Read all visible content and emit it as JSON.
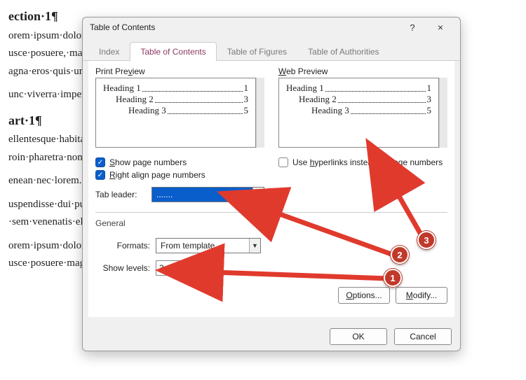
{
  "bg": {
    "heading1": "ection·1¶",
    "p1": "orem·ipsum·dolor·sit·amet,·consectetuer·adipiscing·elit.·Maecenas·porttitor·congue·mass",
    "p2": "usce·posuere,·magna·sed·pulvinar·ultricies,·purus·lectus·malesuada·libero,·sit·amet·commod",
    "p3": "agna·eros·quis·urna.¶",
    "p4": "unc·viverra·imperdiet·enim.·Fusce·est.·Vivamus·a·tellus.¶",
    "heading2": "art·1¶",
    "p5": "ellentesque·habitant·morbi·tristique·senectus·et·netus·et·malesuada·fames·ac·turpis·egesta",
    "p6": "roin·pharetra·nonummy·pede.·Mauris·et·orci.¶",
    "p7": "enean·nec·lorem.·In·porttitor.·Donec·laoreet·nonummy·augue.¶",
    "p8": "uspendisse·dui·purus,·scelerisque·at,·vulputate·vitae,·pretium·mattis,·nunc.·Mauris·eget·nequ",
    "p9": "·sem·venenatis·eleifend.·Ut·nonummy.¶",
    "p10": "orem·ipsum·dolor·sit·amet,·consectetuer·adipiscing·elit.·Maecenas·porttitor·congue·mass",
    "p11": "usce·posuere·magna·sed·pulvinar·ultricies·purus·lectus·malesuada·libero·sit·amet·commod"
  },
  "dialog": {
    "title": "Table of Contents",
    "help": "?",
    "close": "×",
    "tabs": [
      "Index",
      "Table of Contents",
      "Table of Figures",
      "Table of Authorities"
    ],
    "print_preview_label": "Print Preview",
    "web_preview_label": "Web Preview",
    "preview_rows": [
      {
        "label": "Heading 1",
        "page": "1",
        "indent": 0
      },
      {
        "label": "Heading 2",
        "page": "3",
        "indent": 1
      },
      {
        "label": "Heading 3",
        "page": "5",
        "indent": 2
      }
    ],
    "show_page_numbers": "Show page numbers",
    "right_align": "Right align page numbers",
    "use_hyperlinks": "Use hyperlinks instead of page numbers",
    "tab_leader_label": "Tab leader:",
    "tab_leader_value": ".......",
    "general_label": "General",
    "formats_label": "Formats:",
    "formats_value": "From template",
    "show_levels_label": "Show levels:",
    "show_levels_value": "3",
    "options_btn": "Options...",
    "modify_btn": "Modify...",
    "ok_btn": "OK",
    "cancel_btn": "Cancel"
  },
  "badges": {
    "b1": "1",
    "b2": "2",
    "b3": "3"
  }
}
